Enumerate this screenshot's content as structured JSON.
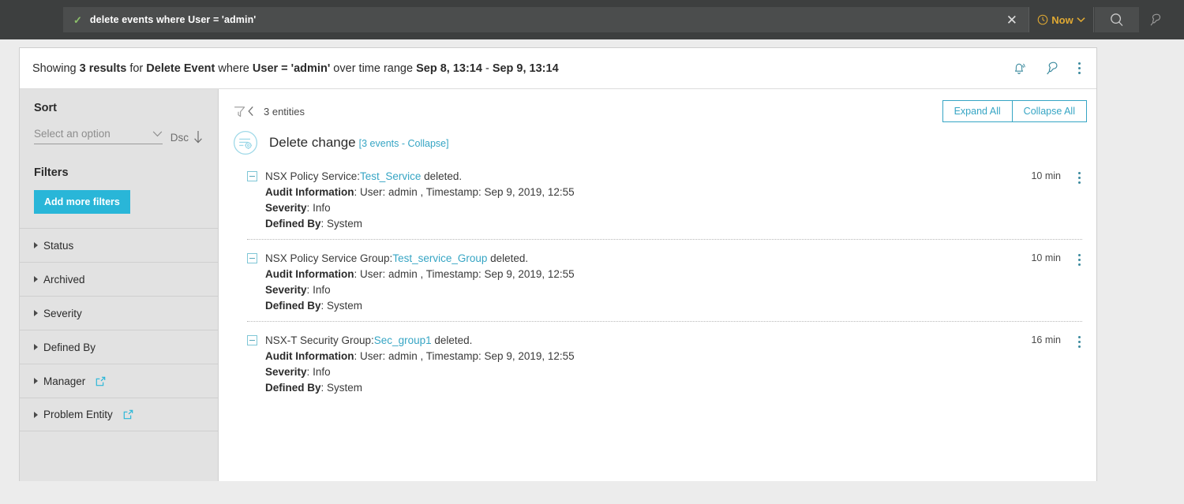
{
  "topbar": {
    "query": "delete events where User = 'admin'",
    "check_icon": "check-icon",
    "clear_label": "✕",
    "time_label": "Now",
    "clock_icon": "clock-icon",
    "search_icon": "search-icon",
    "pin_icon": "pin-icon",
    "accent_yellow": "#e0a933",
    "check_green": "#8cc06a"
  },
  "header": {
    "prefix": "Showing ",
    "results": "3 results",
    "mid1": " for ",
    "event_type": "Delete Event",
    "mid2": " where ",
    "condition": "User = 'admin'",
    "mid3": " over time range ",
    "time_start": "Sep 8, 13:14",
    "time_dash": " - ",
    "time_end": "Sep 9, 13:14",
    "bell_icon": "bell-alert-icon",
    "pin_icon": "pin-icon",
    "menu_icon": "more-vertical-icon"
  },
  "sidebar": {
    "sort_title": "Sort",
    "sort_placeholder": "Select an option",
    "sort_direction": "Dsc",
    "filters_title": "Filters",
    "add_filters_label": "Add more filters",
    "accent": "#29b6d8",
    "filters": [
      {
        "label": "Status",
        "external": false
      },
      {
        "label": "Archived",
        "external": false
      },
      {
        "label": "Severity",
        "external": false
      },
      {
        "label": "Defined By",
        "external": false
      },
      {
        "label": "Manager",
        "external": true
      },
      {
        "label": "Problem Entity",
        "external": true
      }
    ]
  },
  "main": {
    "filter_icon": "filter-collapse-icon",
    "entities_count": "3 entities",
    "expand_all": "Expand All",
    "collapse_all": "Collapse All",
    "accent_teal": "#36a5c4",
    "group": {
      "icon": "change-settings-icon",
      "title": "Delete change",
      "meta": "[3 events - Collapse]"
    },
    "events": [
      {
        "entity_type": "NSX Policy Service:",
        "entity_name": "Test_Service",
        "suffix": " deleted.",
        "audit_label": "Audit Information",
        "audit_value": "User: admin , Timestamp: Sep 9, 2019, 12:55",
        "severity_label": "Severity",
        "severity_value": "Info",
        "defined_label": "Defined By",
        "defined_value": "System",
        "time": "10 min"
      },
      {
        "entity_type": "NSX Policy Service Group:",
        "entity_name": "Test_service_Group",
        "suffix": " deleted.",
        "audit_label": "Audit Information",
        "audit_value": "User: admin , Timestamp: Sep 9, 2019, 12:55",
        "severity_label": "Severity",
        "severity_value": "Info",
        "defined_label": "Defined By",
        "defined_value": "System",
        "time": "10 min"
      },
      {
        "entity_type": "NSX-T Security Group:",
        "entity_name": "Sec_group1",
        "suffix": " deleted.",
        "audit_label": "Audit Information",
        "audit_value": "User: admin , Timestamp: Sep 9, 2019, 12:55",
        "severity_label": "Severity",
        "severity_value": "Info",
        "defined_label": "Defined By",
        "defined_value": "System",
        "time": "16 min"
      }
    ]
  }
}
